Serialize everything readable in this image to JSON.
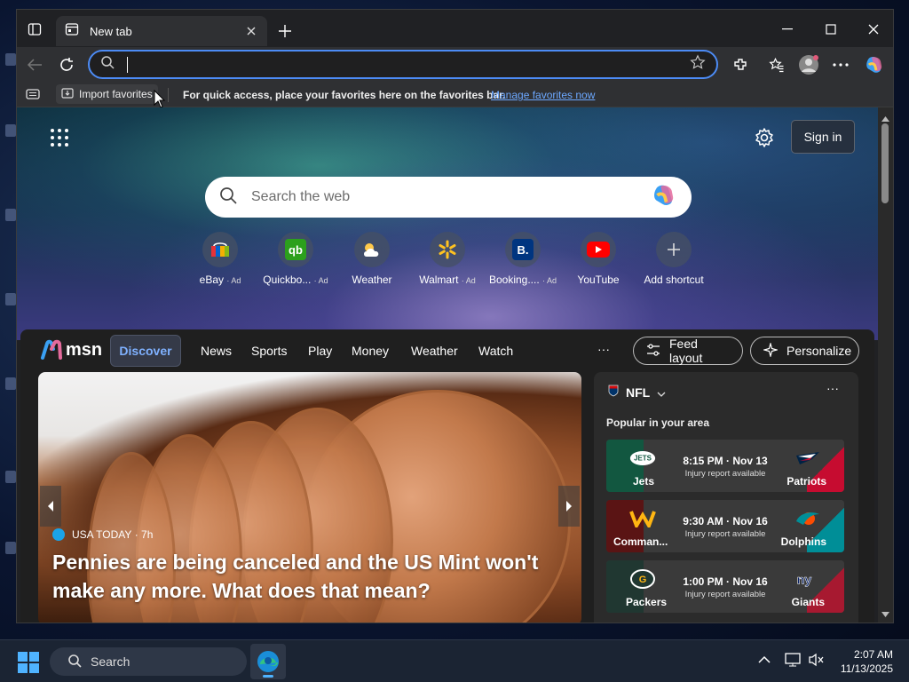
{
  "colors": {
    "accent": "#4c8bf5",
    "link": "#6ca8ff",
    "discover": "#7fb1ff",
    "taskbar": "#1b2433"
  },
  "tab": {
    "title": "New tab"
  },
  "address_bar": {
    "value": ""
  },
  "favorites_bar": {
    "import_label": "Import favorites",
    "message": "For quick access, place your favorites here on the favorites bar.",
    "manage_link": "Manage favorites now"
  },
  "new_tab_page": {
    "signin_label": "Sign in",
    "search_placeholder": "Search the web",
    "shortcuts": [
      {
        "label": "eBay",
        "ad": "· Ad",
        "icon": "ebay-icon"
      },
      {
        "label": "Quickbo...",
        "ad": "· Ad",
        "icon": "quickbooks-icon"
      },
      {
        "label": "Weather",
        "ad": "",
        "icon": "weather-icon"
      },
      {
        "label": "Walmart",
        "ad": "· Ad",
        "icon": "walmart-icon"
      },
      {
        "label": "Booking....",
        "ad": "· Ad",
        "icon": "booking-icon"
      },
      {
        "label": "YouTube",
        "ad": "",
        "icon": "youtube-icon"
      },
      {
        "label": "Add shortcut",
        "ad": "",
        "icon": "plus-icon"
      }
    ]
  },
  "feed": {
    "logo_text": "msn",
    "nav": [
      "Discover",
      "News",
      "Sports",
      "Play",
      "Money",
      "Weather",
      "Watch"
    ],
    "more": "···",
    "feed_layout_label": "Feed layout",
    "personalize_label": "Personalize",
    "hero": {
      "source": "USA TODAY",
      "age": "· 7h",
      "title": "Pennies are being canceled and the US Mint won't make any more. What does that mean?"
    },
    "nfl": {
      "title": "NFL",
      "subtitle": "Popular in your area",
      "games": [
        {
          "home": "Jets",
          "away": "Patriots",
          "time": "8:15 PM · Nov 13",
          "note": "Injury report available"
        },
        {
          "home": "Comman...",
          "away": "Dolphins",
          "time": "9:30 AM · Nov 16",
          "note": "Injury report available"
        },
        {
          "home": "Packers",
          "away": "Giants",
          "time": "1:00 PM · Nov 16",
          "note": "Injury report available"
        }
      ]
    }
  },
  "taskbar": {
    "search_label": "Search",
    "time": "2:07 AM",
    "date": "11/13/2025"
  }
}
